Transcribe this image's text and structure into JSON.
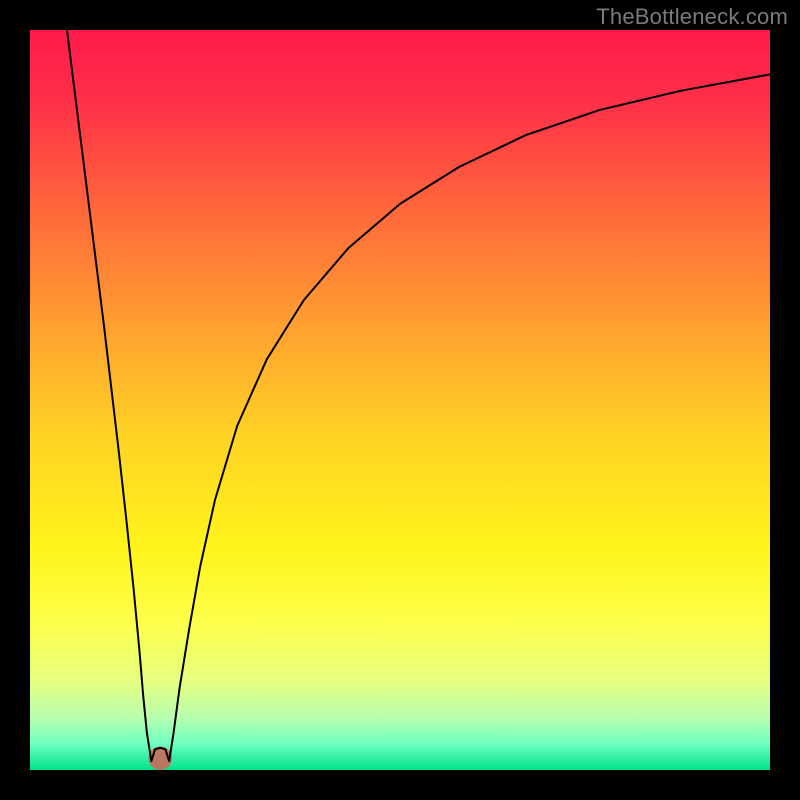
{
  "watermark": "TheBottleneck.com",
  "chart_data": {
    "type": "line",
    "title": "",
    "xlabel": "",
    "ylabel": "",
    "xlim": [
      0,
      100
    ],
    "ylim": [
      0,
      100
    ],
    "grid": false,
    "axes_visible": false,
    "background_gradient": {
      "stops": [
        {
          "pos": 0.0,
          "color": "#ff1a4b"
        },
        {
          "pos": 0.1,
          "color": "#ff3148"
        },
        {
          "pos": 0.25,
          "color": "#ff6a3a"
        },
        {
          "pos": 0.4,
          "color": "#ffa030"
        },
        {
          "pos": 0.55,
          "color": "#ffd324"
        },
        {
          "pos": 0.7,
          "color": "#fff41a"
        },
        {
          "pos": 0.8,
          "color": "#fdff4a"
        },
        {
          "pos": 0.88,
          "color": "#e6ff80"
        },
        {
          "pos": 0.93,
          "color": "#b7ffb0"
        },
        {
          "pos": 0.965,
          "color": "#6dffc0"
        },
        {
          "pos": 1.0,
          "color": "#00e38a"
        }
      ]
    },
    "series": [
      {
        "name": "left-branch",
        "x": [
          5.0,
          6.0,
          7.0,
          8.0,
          9.0,
          10.0,
          11.0,
          12.0,
          13.0,
          14.0,
          14.8,
          15.3,
          15.8,
          16.4
        ],
        "y": [
          100.0,
          92.0,
          84.0,
          76.0,
          68.0,
          60.0,
          51.5,
          43.0,
          34.0,
          24.5,
          16.0,
          10.0,
          5.0,
          1.2
        ]
      },
      {
        "name": "notch-cap",
        "x": [
          16.4,
          16.9,
          17.6,
          18.3,
          18.8
        ],
        "y": [
          1.2,
          2.8,
          3.0,
          2.8,
          1.2
        ]
      },
      {
        "name": "right-branch",
        "x": [
          18.8,
          19.4,
          20.2,
          21.5,
          23.0,
          25.0,
          28.0,
          32.0,
          37.0,
          43.0,
          50.0,
          58.0,
          67.0,
          77.0,
          88.0,
          100.0
        ],
        "y": [
          1.2,
          5.0,
          11.0,
          19.0,
          27.5,
          36.5,
          46.5,
          55.5,
          63.5,
          70.5,
          76.5,
          81.5,
          85.8,
          89.2,
          91.8,
          94.0
        ]
      }
    ],
    "notch_marker": {
      "cx": 17.6,
      "cy": 1.6,
      "rx": 1.6,
      "ry": 1.6,
      "color": "#c96a5a"
    }
  }
}
